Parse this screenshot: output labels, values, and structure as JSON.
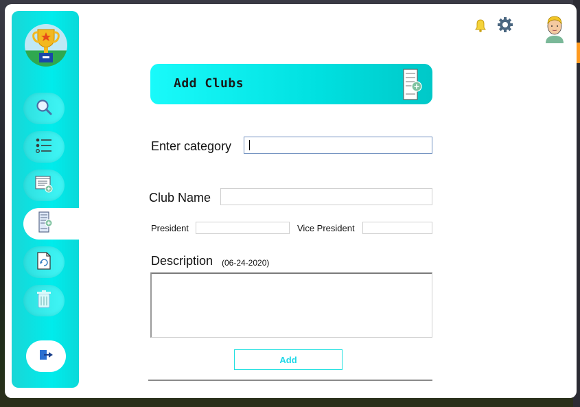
{
  "header": {
    "title": "Add Clubs"
  },
  "form": {
    "category_label": "Enter category",
    "category_value": "",
    "club_name_label": "Club Name",
    "club_name_value": "",
    "president_label": "President",
    "president_value": "",
    "vice_president_label": "Vice President",
    "vice_president_value": "",
    "description_label": "Description",
    "description_date": "(06-24-2020)",
    "description_value": "",
    "add_button_label": "Add"
  },
  "sidebar": {
    "items": [
      {
        "name": "search",
        "icon": "search-icon"
      },
      {
        "name": "list",
        "icon": "list-icon"
      },
      {
        "name": "notes",
        "icon": "notes-add-icon"
      },
      {
        "name": "add-club",
        "icon": "club-add-icon",
        "active": true
      },
      {
        "name": "update",
        "icon": "refresh-doc-icon"
      },
      {
        "name": "delete",
        "icon": "trash-icon"
      }
    ],
    "logout_icon": "logout-icon"
  },
  "colors": {
    "accent": "#00e8e8",
    "active_bg": "#ffffff",
    "button_text": "#1fd8e8"
  }
}
